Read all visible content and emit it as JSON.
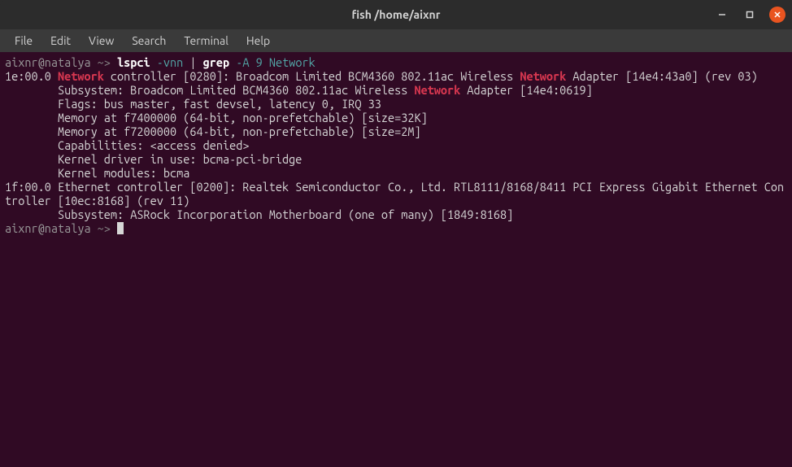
{
  "window": {
    "title": "fish  /home/aixnr"
  },
  "menubar": {
    "items": [
      "File",
      "Edit",
      "View",
      "Search",
      "Terminal",
      "Help"
    ]
  },
  "terminal": {
    "prompt_user": "aixnr@natalya",
    "prompt_sep": " ~> ",
    "command": {
      "cmd1": "lspci",
      "opt1": " -vnn",
      "pipe": " | ",
      "cmd2": "grep",
      "opt2": " -A 9 Network"
    },
    "output": {
      "l1_pre": "1e:00.0 ",
      "l1_hl1": "Network",
      "l1_mid": " controller [0280]: Broadcom Limited BCM4360 802.11ac Wireless ",
      "l1_hl2": "Network",
      "l1_post": " Adapter [14e4:43a0] (rev 03)",
      "l2_pre": "        Subsystem: Broadcom Limited BCM4360 802.11ac Wireless ",
      "l2_hl": "Network",
      "l2_post": " Adapter [14e4:0619]",
      "l3": "        Flags: bus master, fast devsel, latency 0, IRQ 33",
      "l4": "        Memory at f7400000 (64-bit, non-prefetchable) [size=32K]",
      "l5": "        Memory at f7200000 (64-bit, non-prefetchable) [size=2M]",
      "l6": "        Capabilities: <access denied>",
      "l7": "        Kernel driver in use: bcma-pci-bridge",
      "l8": "        Kernel modules: bcma",
      "l9": "",
      "l10": "1f:00.0 Ethernet controller [0200]: Realtek Semiconductor Co., Ltd. RTL8111/8168/8411 PCI Express Gigabit Ethernet Controller [10ec:8168] (rev 11)",
      "l11": "        Subsystem: ASRock Incorporation Motherboard (one of many) [1849:8168]"
    }
  }
}
